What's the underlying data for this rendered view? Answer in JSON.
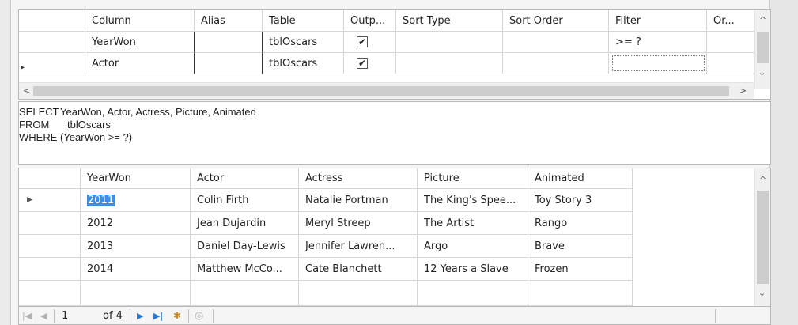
{
  "criteria": {
    "headers": [
      "Column",
      "Alias",
      "Table",
      "Outp...",
      "Sort Type",
      "Sort Order",
      "Filter",
      "Or..."
    ],
    "rows": [
      {
        "column": "YearWon",
        "alias": "",
        "table": "tblOscars",
        "output": "✔",
        "sort_type": "",
        "sort_order": "",
        "filter": ">= ?",
        "or": ""
      },
      {
        "column": "Actor",
        "alias": "",
        "table": "tblOscars",
        "output": "✔",
        "sort_type": "",
        "sort_order": "",
        "filter": "",
        "or": ""
      }
    ],
    "row_indicator": "▸"
  },
  "scroll": {
    "up": "^",
    "down": "⌄",
    "left": "<",
    "right": ">"
  },
  "sql": {
    "select_kw": "SELECT",
    "select_val": "YearWon, Actor, Actress, Picture, Animated",
    "from_kw": "FROM",
    "from_val": "tblOscars",
    "where_kw": "WHERE",
    "where_val": "(YearWon >= ?)"
  },
  "results": {
    "headers": [
      "YearWon",
      "Actor",
      "Actress",
      "Picture",
      "Animated"
    ],
    "current_row_indicator": "▶",
    "rows": [
      {
        "year": "2011",
        "actor": "Colin Firth",
        "actress": "Natalie Portman",
        "picture": "The King's Spee...",
        "animated": "Toy Story 3"
      },
      {
        "year": "2012",
        "actor": "Jean Dujardin",
        "actress": "Meryl Streep",
        "picture": "The Artist",
        "animated": "Rango"
      },
      {
        "year": "2013",
        "actor": "Daniel Day-Lewis",
        "actress": "Jennifer Lawren...",
        "picture": "Argo",
        "animated": "Brave"
      },
      {
        "year": "2014",
        "actor": "Matthew McCo...",
        "actress": "Cate Blanchett",
        "picture": "12 Years a Slave",
        "animated": "Frozen"
      }
    ]
  },
  "navigator": {
    "first": "|◀",
    "prev": "◀",
    "position": "1",
    "of_total": "of 4",
    "next": "▶",
    "last": "▶|",
    "new": "✱",
    "stop": "◎"
  },
  "colors": {
    "selection": "#3a8ee6",
    "nav_blue": "#2b78d0",
    "border": "#b9b9b9"
  }
}
